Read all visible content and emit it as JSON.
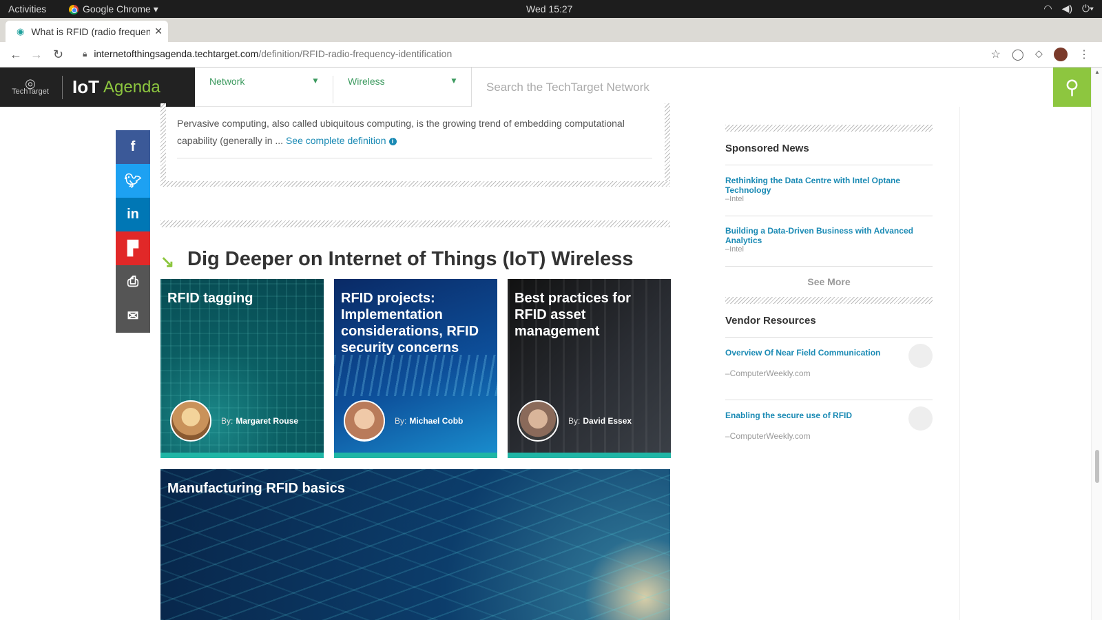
{
  "os": {
    "activities": "Activities",
    "app_name": "Google Chrome ▾",
    "clock": "Wed 15:27",
    "tray_icons": [
      "wifi-icon",
      "volume-icon",
      "power-icon"
    ]
  },
  "browser": {
    "tab_title": "What is RFID (radio frequency identification)",
    "url_domain": "internetofthingsagenda.techtarget.com",
    "url_path": "/definition/RFID-radio-frequency-identification"
  },
  "site": {
    "brand_techtarget": "TechTarget",
    "brand_iot": "IoT",
    "brand_agenda": "Agenda",
    "nav": [
      {
        "label": "Network"
      },
      {
        "label": "Wireless"
      }
    ],
    "search_placeholder": "Search the TechTarget Network",
    "accent": "#8dc63f"
  },
  "definition": {
    "text": "Pervasive computing, also called ubiquitous computing, is the growing trend of embedding computational capability (generally in ...",
    "link": "See complete definition",
    "info_glyph": "i"
  },
  "dig_deeper": {
    "title": "Dig Deeper on Internet of Things (IoT) Wireless",
    "by_label": "By:",
    "cards": [
      {
        "title": "RFID tagging",
        "author": "Margaret Rouse"
      },
      {
        "title": "RFID projects: Implementation considerations, RFID security concerns",
        "author": "Michael Cobb"
      },
      {
        "title": "Best practices for RFID asset management",
        "author": "David Essex"
      }
    ],
    "banner_title": "Manufacturing RFID basics"
  },
  "share": [
    "facebook-icon",
    "twitter-icon",
    "linkedin-icon",
    "flipboard-icon",
    "print-icon",
    "email-icon"
  ],
  "sidebar": {
    "sponsored_heading": "Sponsored News",
    "sponsored": [
      {
        "title": "Rethinking the Data Centre with Intel Optane Technology",
        "source": "–Intel"
      },
      {
        "title": "Building a Data-Driven Business with Advanced Analytics",
        "source": "–Intel"
      }
    ],
    "see_more": "See More",
    "vendor_heading": "Vendor Resources",
    "vendor": [
      {
        "title": "Overview Of Near Field Communication",
        "source": "–ComputerWeekly.com"
      },
      {
        "title": "Enabling the secure use of RFID",
        "source": "–ComputerWeekly.com"
      }
    ]
  }
}
